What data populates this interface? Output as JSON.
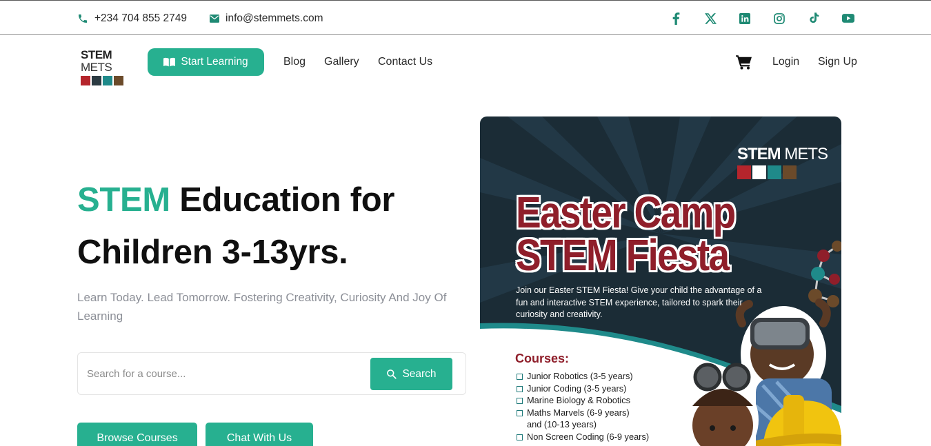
{
  "topbar": {
    "phone": "+234 704 855 2749",
    "email": "info@stemmets.com",
    "socials": [
      "facebook-icon",
      "x-twitter-icon",
      "linkedin-icon",
      "instagram-icon",
      "tiktok-icon",
      "youtube-icon"
    ]
  },
  "nav": {
    "logo": {
      "word1": "STEM",
      "word2": " METS"
    },
    "start_learning": "Start Learning",
    "links": [
      "Blog",
      "Gallery",
      "Contact Us"
    ],
    "login": "Login",
    "signup": "Sign Up"
  },
  "hero": {
    "headline_accent": "STEM",
    "headline_rest_1": " Education for",
    "headline_line_2": "Children 3-13yrs.",
    "subline": "Learn Today. Lead Tomorrow. Fostering Creativity, Curiosity And Joy Of Learning",
    "search_placeholder": "Search for a course...",
    "search_button": "Search",
    "browse_courses": "Browse Courses",
    "chat_with_us": "Chat With Us"
  },
  "poster": {
    "logo_word1": "STEM",
    "logo_word2": " METS",
    "title_line1": "Easter Camp",
    "title_line2": "STEM Fiesta",
    "description": "Join our Easter STEM Fiesta! Give your child the advantage of a fun and interactive STEM experience, tailored to spark their curiosity and creativity.",
    "courses_heading": "Courses:",
    "courses": [
      "Junior Robotics (3-5 years)",
      "Junior Coding (3-5 years)",
      "Marine Biology & Robotics",
      "Maths Marvels (6-9 years)",
      "and (10-13 years)",
      "Non Screen Coding (6-9 years)"
    ]
  },
  "colors": {
    "brand_teal": "#27b090",
    "poster_bg": "#1b2c36",
    "poster_red": "#8f1e2a",
    "logo_tiles": [
      "#b5252c",
      "#2b3a42",
      "#1f8a8a",
      "#6b4a2a"
    ]
  }
}
